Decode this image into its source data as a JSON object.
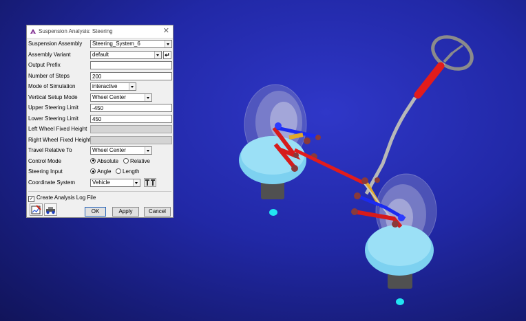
{
  "dialog": {
    "title": "Suspension Analysis: Steering",
    "rows": [
      {
        "label": "Suspension Assembly",
        "value": "Steering_System_6"
      },
      {
        "label": "Assembly Variant",
        "value": "default"
      },
      {
        "label": "Output Prefix",
        "value": ""
      },
      {
        "label": "Number of Steps",
        "value": "200"
      },
      {
        "label": "Mode of Simulation",
        "value": "interactive"
      },
      {
        "label": "Vertical Setup Mode",
        "value": "Wheel Center"
      },
      {
        "label": "Upper Steering Limit",
        "value": "-450"
      },
      {
        "label": "Lower Steering Limit",
        "value": "450"
      },
      {
        "label": "Left Wheel Fixed Height",
        "value": ""
      },
      {
        "label": "Right Wheel Fixed Height",
        "value": ""
      },
      {
        "label": "Travel Relative To",
        "value": "Wheel Center"
      },
      {
        "label": "Control Mode",
        "options": [
          "Absolute",
          "Relative"
        ],
        "selected": "Absolute"
      },
      {
        "label": "Steering Input",
        "options": [
          "Angle",
          "Length"
        ],
        "selected": "Angle"
      },
      {
        "label": "Coordinate System",
        "value": "Vehicle"
      }
    ],
    "log_checkbox": {
      "label": "Create Analysis Log File",
      "checked": true
    },
    "buttons": {
      "ok": "OK",
      "apply": "Apply",
      "cancel": "Cancel"
    }
  },
  "scene": {
    "background": "#1f26a0",
    "accent_red": "#e11d1d",
    "accent_cyan": "#6fd6f0",
    "accent_blue": "#1818e8",
    "steering_wheel_color": "#8a8a8a"
  }
}
